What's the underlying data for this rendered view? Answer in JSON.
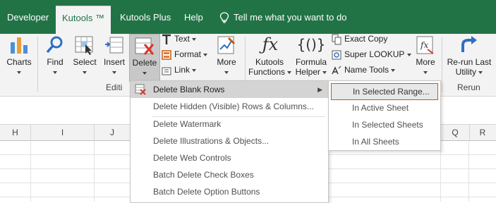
{
  "tabs": {
    "developer": "Developer",
    "kutools": "Kutools ™",
    "kutools_plus": "Kutools Plus",
    "help": "Help",
    "tell_me": "Tell me what you want to do"
  },
  "ribbon": {
    "charts": "Charts",
    "find": "Find",
    "select": "Select",
    "insert": "Insert",
    "delete": "Delete",
    "text": "Text",
    "format": "Format",
    "link": "Link",
    "more": "More",
    "group_editing_partial": "Editi",
    "kutools_functions_line1": "Kutools",
    "kutools_functions_line2": "Functions",
    "formula_helper_line1": "Formula",
    "formula_helper_line2": "Helper",
    "exact_copy": "Exact Copy",
    "super_lookup": "Super LOOKUP",
    "name_tools": "Name Tools",
    "more2": "More",
    "rerun_line1": "Re-run Last",
    "rerun_line2": "Utility",
    "group_rerun": "Rerun"
  },
  "columns": [
    "H",
    "I",
    "J",
    "Q",
    "R"
  ],
  "delete_menu": {
    "items": [
      "Delete Blank Rows",
      "Delete Hidden (Visible) Rows & Columns...",
      "Delete Watermark",
      "Delete Illustrations & Objects...",
      "Delete Web Controls",
      "Batch Delete Check Boxes",
      "Batch Delete Option Buttons"
    ]
  },
  "submenu": {
    "items": [
      "In Selected Range...",
      "In Active Sheet",
      "In Selected Sheets",
      "In All Sheets"
    ]
  },
  "colors": {
    "brand_green": "#217346",
    "highlight_border": "#c55a11",
    "delete_red": "#d9352b"
  }
}
